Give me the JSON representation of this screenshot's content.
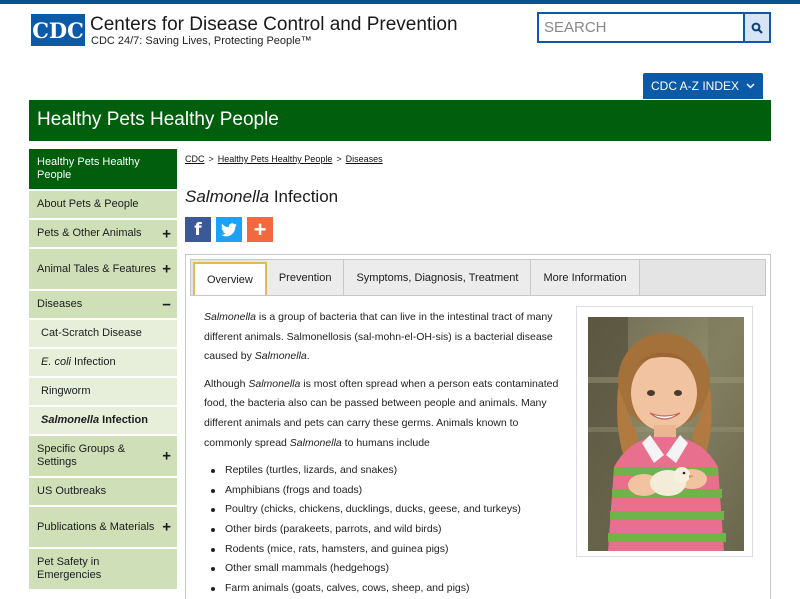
{
  "header": {
    "logo_text": "CDC",
    "site_name": "Centers for Disease Control and Prevention",
    "tagline": "CDC 24/7: Saving Lives, Protecting People™",
    "search_placeholder": "SEARCH",
    "az_index_label": "CDC A-Z INDEX"
  },
  "banner": {
    "title": "Healthy Pets Healthy People"
  },
  "sidebar": {
    "items": [
      {
        "label": "Healthy Pets Healthy People",
        "sign": ""
      },
      {
        "label": "About Pets & People",
        "sign": ""
      },
      {
        "label": "Pets & Other Animals",
        "sign": "+"
      },
      {
        "label": "Animal Tales & Features",
        "sign": "+"
      },
      {
        "label": "Diseases",
        "sign": "−"
      },
      {
        "label": "Cat-Scratch Disease",
        "sign": ""
      },
      {
        "label_italic": "E. coli",
        "label_rest": " Infection",
        "sign": ""
      },
      {
        "label": "Ringworm",
        "sign": ""
      },
      {
        "label_italic": "Salmonella",
        "label_rest": " Infection",
        "sign": ""
      },
      {
        "label": "Specific Groups & Settings",
        "sign": "+"
      },
      {
        "label": "US Outbreaks",
        "sign": ""
      },
      {
        "label": "Publications & Materials",
        "sign": "+"
      },
      {
        "label": "Pet Safety in Emergencies",
        "sign": ""
      }
    ]
  },
  "breadcrumb": {
    "items": [
      "CDC",
      "Healthy Pets Healthy People",
      "Diseases"
    ],
    "separator": ">"
  },
  "page": {
    "title_italic": "Salmonella",
    "title_rest": " Infection"
  },
  "social": {
    "facebook_letter": "f",
    "plus_symbol": "+"
  },
  "tabs": [
    "Overview",
    "Prevention",
    "Symptoms, Diagnosis, Treatment",
    "More Information"
  ],
  "content": {
    "p1": {
      "a_italic": "Salmonella",
      "b": " is a group of bacteria that can live in the intestinal tract of many different animals. Salmonellosis (sal-mohn-el-OH-sis) is a bacterial disease caused by ",
      "c_italic": "Salmonella",
      "d": "."
    },
    "p2": {
      "a": "Although ",
      "b_italic": "Salmonella",
      "c": " is most often spread when a person eats contaminated food, the bacteria also can be passed between people and animals. Many different animals and pets can carry these germs. Animals known to commonly spread ",
      "d_italic": "Salmonella",
      "e": " to humans include"
    },
    "list": [
      "Reptiles (turtles, lizards, and snakes)",
      "Amphibians (frogs and toads)",
      "Poultry (chicks, chickens, ducklings, ducks, geese, and turkeys)",
      "Other birds (parakeets, parrots, and wild birds)",
      "Rodents (mice, rats, hamsters, and guinea pigs)",
      "Other small mammals (hedgehogs)",
      "Farm animals (goats, calves, cows, sheep, and pigs)"
    ]
  },
  "colors": {
    "cdc_blue": "#0b5aa8",
    "banner_green": "#005e0d",
    "side_green": "#cfe0b9",
    "tab_gold": "#e6b856"
  }
}
